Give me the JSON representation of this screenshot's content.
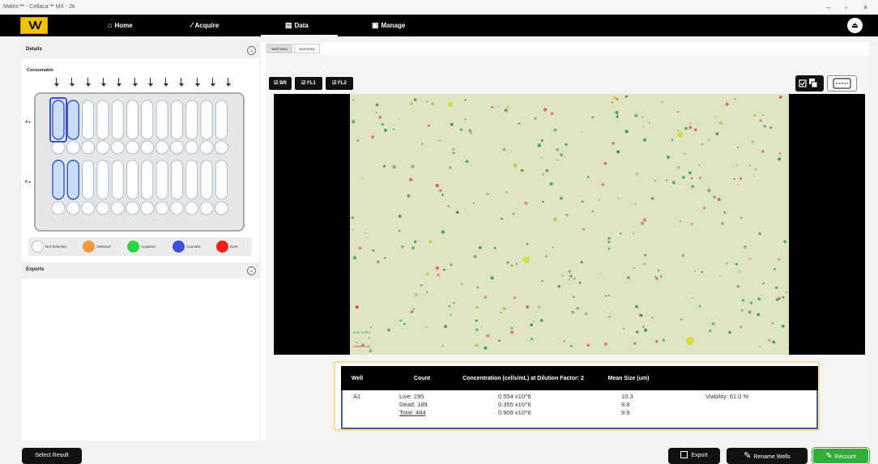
{
  "window": {
    "title": "Matrix™ - Cellaca™ MX - 2k",
    "min": "–",
    "restore": "▫",
    "close": "×"
  },
  "nav": {
    "logo_text": "VV",
    "items": [
      {
        "icon": "home-icon",
        "glyph": "⌂",
        "label": "Home"
      },
      {
        "icon": "pipette-icon",
        "glyph": "⁄",
        "label": "Acquire"
      },
      {
        "icon": "data-icon",
        "glyph": "▤",
        "label": "Data"
      },
      {
        "icon": "manage-icon",
        "glyph": "▣",
        "label": "Manage"
      }
    ],
    "eject_glyph": "⏏"
  },
  "left": {
    "details_title": "Details",
    "consumable_label": "Consumable",
    "row_a": "A ▸",
    "row_b": "B ▸",
    "legend": [
      {
        "label": "Not Selected",
        "color": "#ffffff"
      },
      {
        "label": "Selected",
        "color": "#f29a3c"
      },
      {
        "label": "Acquired",
        "color": "#2ed34a"
      },
      {
        "label": "Counted",
        "color": "#3e4fd3"
      },
      {
        "label": "Error",
        "color": "#f31e1e"
      }
    ],
    "exports_title": "Exports",
    "collapse_glyph": "⌄"
  },
  "tabs": [
    "Well View",
    "Summary"
  ],
  "channels": [
    "☑ BR",
    "☑ FL1",
    "☑ FL2"
  ],
  "overlay": {
    "line1": "ROC WORT",
    "line2": "WDW8 L1B"
  },
  "results": {
    "headers": {
      "well": "Well",
      "count": "Count",
      "concentration": "Concentration (cells/mL) at Dilution Factor: 2",
      "mean_size": "Mean Size (um)"
    },
    "well": "A1",
    "rows": [
      {
        "count": "Live:  295",
        "conc": "0.554 x10^6",
        "size": "10.3"
      },
      {
        "count": "Dead:  189",
        "conc": "0.355 x10^6",
        "size": "9.8"
      },
      {
        "count": "Total:  484",
        "conc": "0.909 x10^6",
        "size": "9.9"
      }
    ],
    "viability": "Viability: 61.0 %"
  },
  "bottom": {
    "select_result": "Select Result",
    "export": "Export",
    "rename_wells": "Rename Wells",
    "recount": "Recount"
  },
  "colors": {
    "accent_yellow": "#f2c200",
    "recount_green": "#2fae3a",
    "counted_blue": "#3e4fd3"
  }
}
